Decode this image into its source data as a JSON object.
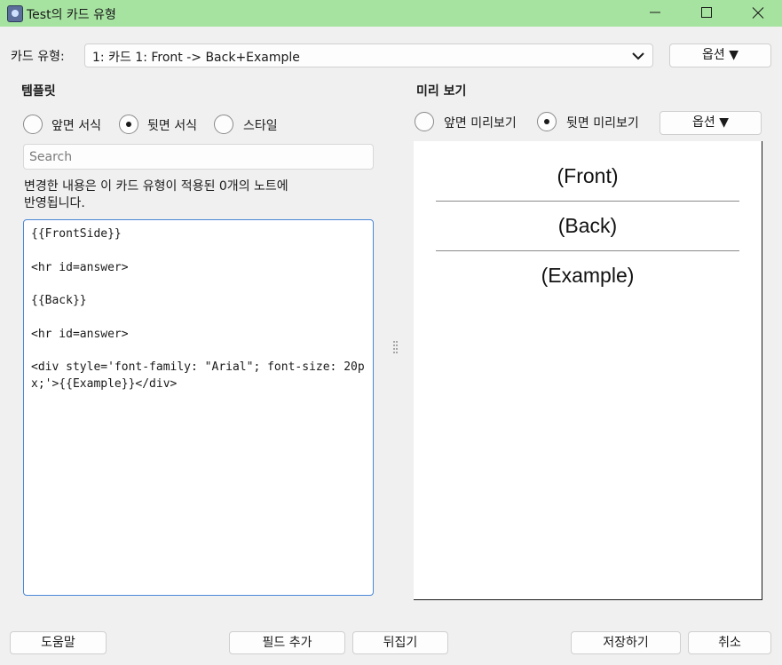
{
  "window": {
    "title": "Test의 카드 유형",
    "icon": "anki-icon",
    "accent_color": "#a6e3a1"
  },
  "card_type": {
    "label": "카드 유형:",
    "selected": "1: 카드 1: Front -> Back+Example",
    "options_button": "옵션 ▼"
  },
  "template": {
    "heading": "템플릿",
    "radios": [
      {
        "label": "앞면 서식",
        "checked": false
      },
      {
        "label": "뒷면 서식",
        "checked": true
      },
      {
        "label": "스타일",
        "checked": false
      }
    ],
    "search_placeholder": "Search",
    "notice": "변경한 내용은 이 카드 유형이 적용된 0개의 노트에\n반영됩니다.",
    "code": "{{FrontSide}}\n\n<hr id=answer>\n\n{{Back}}\n\n<hr id=answer>\n\n<div style='font-family: \"Arial\"; font-size: 20px;'>{{Example}}</div>"
  },
  "preview": {
    "heading": "미리 보기",
    "radios": [
      {
        "label": "앞면 미리보기",
        "checked": false
      },
      {
        "label": "뒷면 미리보기",
        "checked": true
      }
    ],
    "options_button": "옵션 ▼",
    "content": {
      "front": "(Front)",
      "back": "(Back)",
      "example": "(Example)"
    }
  },
  "footer": {
    "help": "도움말",
    "add_field": "필드 추가",
    "flip": "뒤집기",
    "save": "저장하기",
    "cancel": "취소"
  }
}
